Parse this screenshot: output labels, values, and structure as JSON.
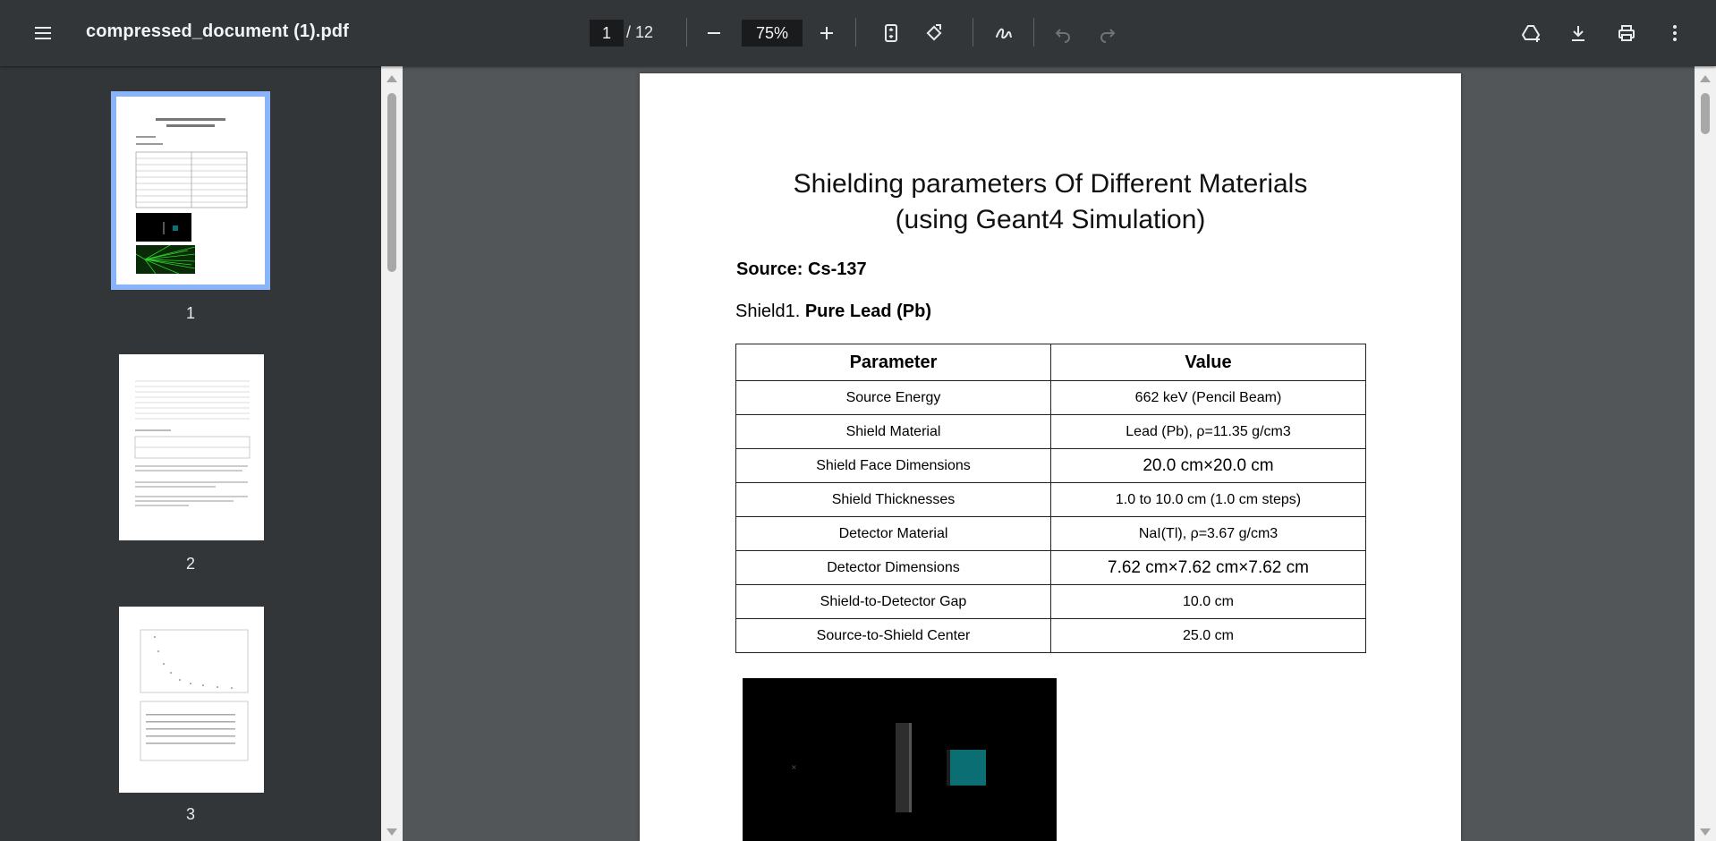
{
  "toolbar": {
    "title": "compressed_document (1).pdf",
    "page_current": "1",
    "page_total": "/ 12",
    "zoom": "75%",
    "icons": [
      "menu-icon",
      "zoom-out-icon",
      "zoom-in-icon",
      "fit-page-icon",
      "rotate-icon",
      "draw-icon",
      "undo-icon",
      "redo-icon",
      "drive-save-icon",
      "download-icon",
      "print-icon",
      "more-vert-icon"
    ]
  },
  "thumbnails": [
    {
      "number": "1",
      "selected": true
    },
    {
      "number": "2",
      "selected": false
    },
    {
      "number": "3",
      "selected": false
    }
  ],
  "page": {
    "title_line1": "Shielding parameters Of Different Materials",
    "title_line2": "(using Geant4 Simulation)",
    "source": "Source: Cs-137",
    "shield_prefix": "Shield1. ",
    "shield_name": "Pure Lead (Pb)",
    "table": {
      "headers": [
        "Parameter",
        "Value"
      ],
      "rows": [
        [
          "Source Energy",
          "662 keV (Pencil Beam)"
        ],
        [
          "Shield Material",
          "Lead (Pb),  ρ=11.35 g/cm3"
        ],
        [
          "Shield Face Dimensions",
          "20.0 cm×20.0 cm"
        ],
        [
          "Shield Thicknesses",
          "1.0 to 10.0 cm (1.0 cm steps)"
        ],
        [
          "Detector Material",
          "NaI(Tl),  ρ=3.67 g/cm3"
        ],
        [
          "Detector Dimensions",
          "7.62 cm×7.62 cm×7.62 cm"
        ],
        [
          "Shield-to-Detector Gap",
          "10.0 cm"
        ],
        [
          "Source-to-Shield Center",
          "25.0 cm"
        ]
      ]
    }
  }
}
